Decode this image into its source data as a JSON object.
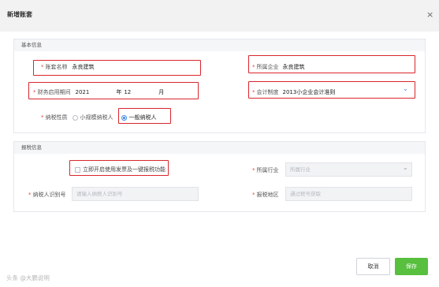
{
  "dialog": {
    "title": "新增账套",
    "close_glyph": "×"
  },
  "basic": {
    "section_title": "基本信息",
    "required_mark": "*",
    "account_name_label": "账套名称",
    "account_name_value": "永良建筑",
    "company_label": "所属企业",
    "company_value": "永良建筑",
    "start_period_label": "财务启用期间",
    "start_year": "2021",
    "year_unit": "年",
    "start_month": "12",
    "month_unit": "月",
    "accounting_system_label": "会计制度",
    "accounting_system_value": "2013小企业会计准则",
    "taxpayer_type_label": "纳税性质",
    "taxpayer_options": [
      {
        "label": "小规模纳税人",
        "selected": false
      },
      {
        "label": "一般纳税人",
        "selected": true
      }
    ]
  },
  "tax": {
    "section_title": "报税信息",
    "invoice_checkbox_label": "立即开启使用发票及一键报税功能",
    "invoice_checkbox_checked": false,
    "industry_label": "所属行业",
    "industry_placeholder": "所属行业",
    "taxpayer_id_label": "纳税人识别号",
    "taxpayer_id_placeholder": "请输入纳税人识别号",
    "tax_region_label": "报税地区",
    "tax_region_placeholder": "通过税号获取"
  },
  "footer": {
    "cancel_label": "取消",
    "save_label": "保存"
  },
  "watermark": "头条 @大鹏说明",
  "colors": {
    "required": "#e8453c",
    "highlight_box": "#d9262c",
    "accent_blue": "#3b8be8",
    "save_green": "#58bf3f"
  },
  "icons": [
    "close-icon",
    "chevron-down-icon"
  ]
}
